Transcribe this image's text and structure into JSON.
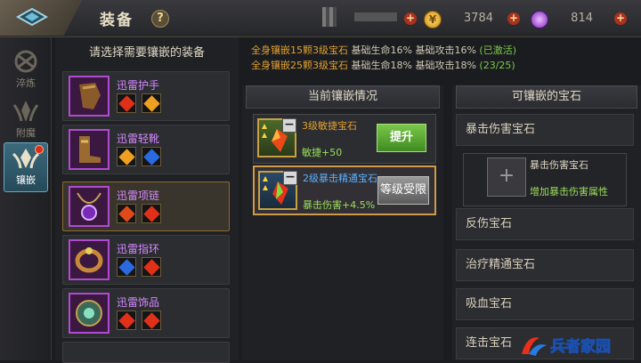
{
  "header": {
    "title": "装备",
    "help": "?",
    "gold": "3784",
    "diamonds": "814"
  },
  "sidebar": {
    "tabs": [
      {
        "label": "淬炼"
      },
      {
        "label": "附魔"
      },
      {
        "label": "镶嵌"
      }
    ]
  },
  "equip": {
    "heading": "请选择需要镶嵌的装备",
    "items": [
      {
        "name": "迅雷护手"
      },
      {
        "name": "迅雷轻靴"
      },
      {
        "name": "迅雷项链"
      },
      {
        "name": "迅雷指环"
      },
      {
        "name": "迅雷饰品"
      }
    ]
  },
  "bonus": {
    "line1_cyan": "全身镶嵌15颗3级宝石",
    "line1_white": " 基础生命16% 基础攻击16%",
    "line1_status": " (已激活)",
    "line2_cyan": "全身镶嵌25颗3级宝石",
    "line2_white": " 基础生命18% 基础攻击18%",
    "line2_status": " (23/25)"
  },
  "current": {
    "heading": "当前镶嵌情况",
    "sockets": [
      {
        "name": "3级敏捷宝石",
        "stat": "敏捷+50",
        "button": "提升",
        "name_color": "#e0a030"
      },
      {
        "name": "2级暴击精通宝石",
        "stat": "暴击伤害+4.5%",
        "button": "等级受限",
        "name_color": "#5ab0ff"
      }
    ]
  },
  "available": {
    "heading": "可镶嵌的宝石",
    "gems": [
      "暴击伤害宝石",
      "反伤宝石",
      "治疗精通宝石",
      "吸血宝石",
      "连击宝石"
    ],
    "expanded": {
      "name": "暴击伤害宝石",
      "desc": "增加暴击伤害属性",
      "plus": "+"
    }
  },
  "watermark": "兵者家园",
  "colors": {
    "accent_gold": "#e0a030",
    "green": "#7ac84a",
    "purple": "#d488ff",
    "blue": "#5ab0ff"
  }
}
